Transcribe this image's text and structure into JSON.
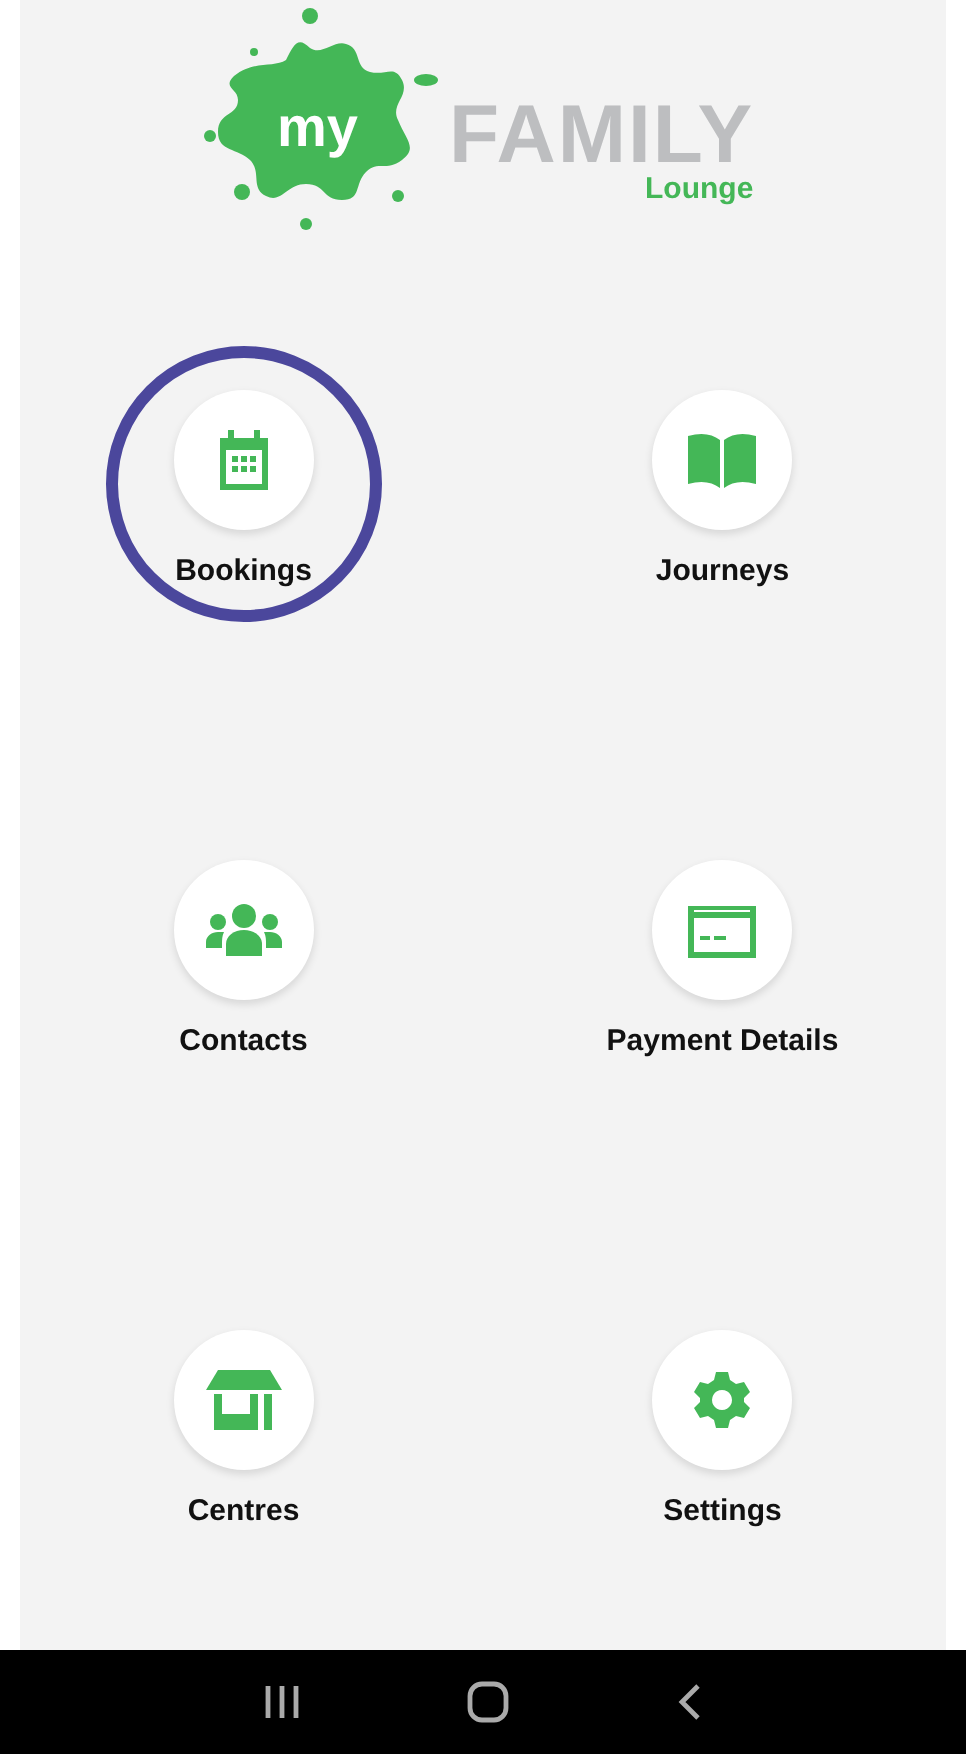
{
  "logo": {
    "badge": "my",
    "name": "FAMILY",
    "subtitle": "Lounge"
  },
  "menu": [
    {
      "label": "Bookings",
      "highlighted": true
    },
    {
      "label": "Journeys",
      "highlighted": false
    },
    {
      "label": "Contacts",
      "highlighted": false
    },
    {
      "label": "Payment Details",
      "highlighted": false
    },
    {
      "label": "Centres",
      "highlighted": false
    },
    {
      "label": "Settings",
      "highlighted": false
    }
  ]
}
